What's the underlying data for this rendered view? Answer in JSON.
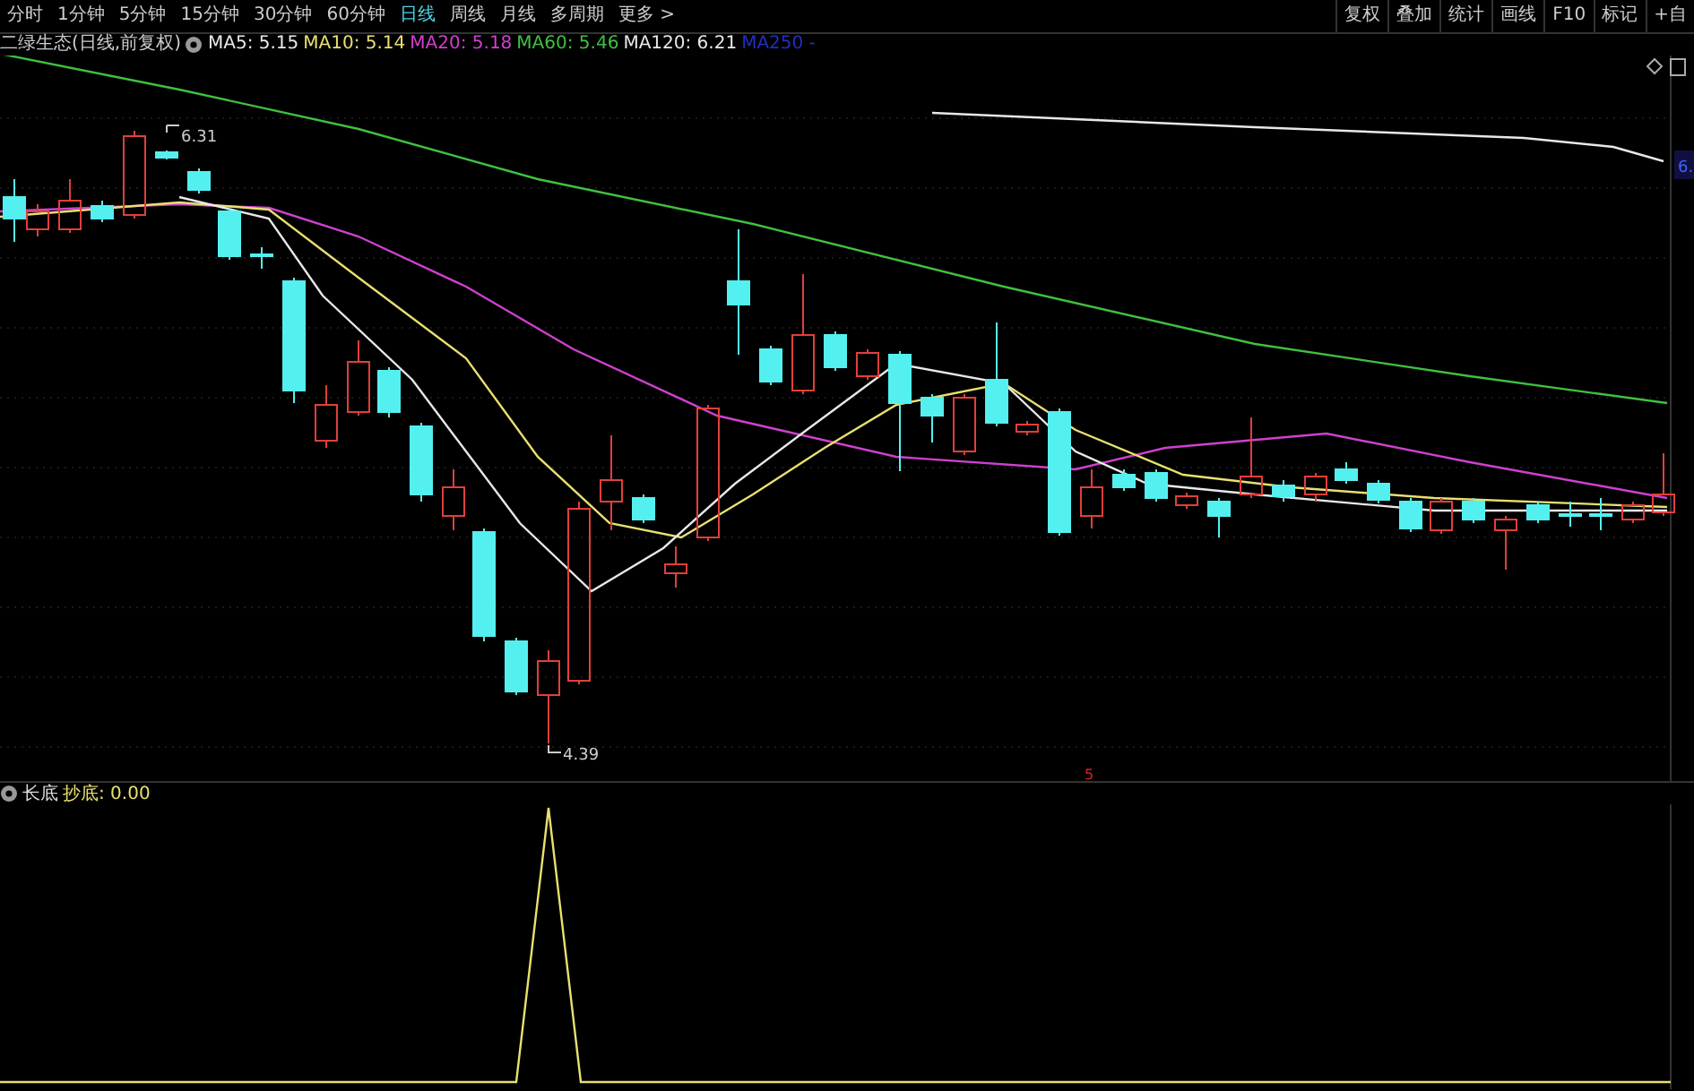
{
  "period_tabs": [
    {
      "label": "分时",
      "selected": false
    },
    {
      "label": "1分钟",
      "selected": false
    },
    {
      "label": "5分钟",
      "selected": false
    },
    {
      "label": "15分钟",
      "selected": false
    },
    {
      "label": "30分钟",
      "selected": false
    },
    {
      "label": "60分钟",
      "selected": false
    },
    {
      "label": "日线",
      "selected": true
    },
    {
      "label": "周线",
      "selected": false
    },
    {
      "label": "月线",
      "selected": false
    },
    {
      "label": "多周期",
      "selected": false
    },
    {
      "label": "更多 >",
      "selected": false
    }
  ],
  "toolbar_buttons": [
    "复权",
    "叠加",
    "统计",
    "画线",
    "F10",
    "标记",
    "+自"
  ],
  "main_chart": {
    "title": "二绿生态(日线,前复权)",
    "moving_averages": [
      {
        "label": "MA5: 5.15",
        "color": "#e8e8e8"
      },
      {
        "label": "MA10: 5.14",
        "color": "#e8e070"
      },
      {
        "label": "MA20: 5.18",
        "color": "#d040d0"
      },
      {
        "label": "MA60: 5.46",
        "color": "#40c040"
      },
      {
        "label": "MA120: 6.21",
        "color": "#e8e8e8"
      },
      {
        "label": "MA250 -",
        "color": "#2030c0"
      }
    ],
    "high_label": "6.31",
    "low_label": "4.39",
    "marker": "5",
    "price_tag": "6."
  },
  "indicator": {
    "name": "长底",
    "value_label": "抄底: 0.00"
  }
}
